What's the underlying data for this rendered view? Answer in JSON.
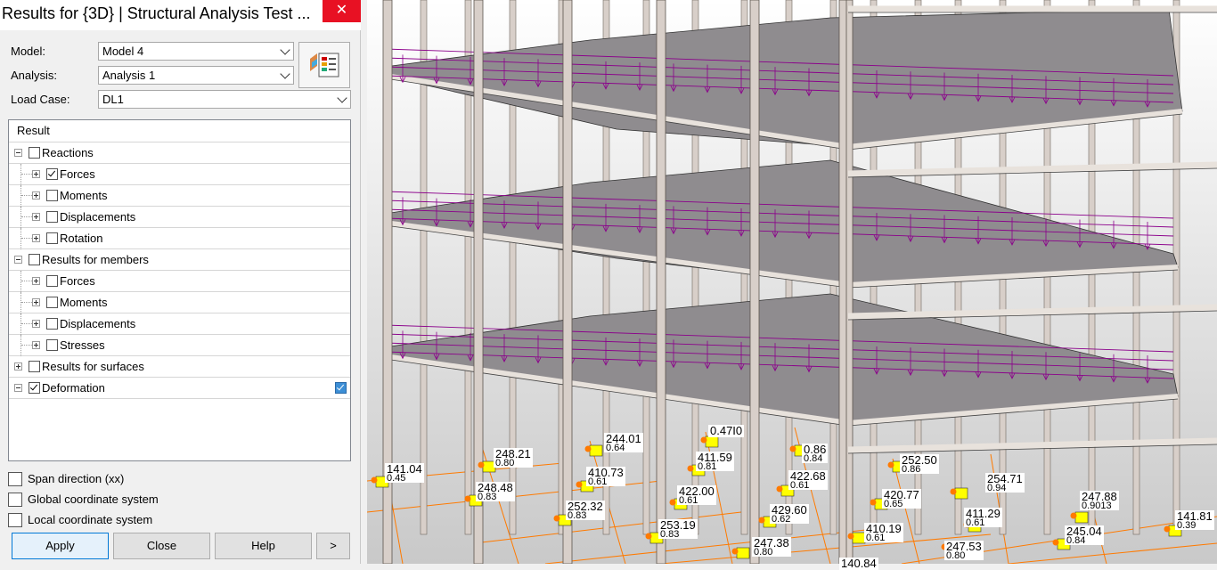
{
  "window": {
    "title": "Results for {3D} | Structural Analysis Test ...",
    "close_glyph": "✕"
  },
  "model": {
    "label": "Model:",
    "value": "Model 4"
  },
  "analysis": {
    "label": "Analysis:",
    "value": "Analysis 1"
  },
  "loadcase": {
    "label": "Load Case:",
    "value": "DL1"
  },
  "tree": {
    "header": "Result",
    "items": [
      {
        "label": "Reactions",
        "level": 0,
        "expanded": true,
        "checked": false
      },
      {
        "label": "Forces",
        "level": 1,
        "expanded": false,
        "checked": true
      },
      {
        "label": "Moments",
        "level": 1,
        "expanded": false,
        "checked": false
      },
      {
        "label": "Displacements",
        "level": 1,
        "expanded": false,
        "checked": false
      },
      {
        "label": "Rotation",
        "level": 1,
        "expanded": false,
        "checked": false
      },
      {
        "label": "Results for members",
        "level": 0,
        "expanded": true,
        "checked": false
      },
      {
        "label": "Forces",
        "level": 1,
        "expanded": false,
        "checked": false
      },
      {
        "label": "Moments",
        "level": 1,
        "expanded": false,
        "checked": false
      },
      {
        "label": "Displacements",
        "level": 1,
        "expanded": false,
        "checked": false
      },
      {
        "label": "Stresses",
        "level": 1,
        "expanded": false,
        "checked": false
      },
      {
        "label": "Results for surfaces",
        "level": 0,
        "expanded": false,
        "checked": false
      },
      {
        "label": "Deformation",
        "level": 0,
        "expanded": true,
        "checked": true
      }
    ]
  },
  "options": {
    "span": "Span direction (xx)",
    "global": "Global coordinate system",
    "local": "Local coordinate system"
  },
  "buttons": {
    "apply": "Apply",
    "close": "Close",
    "help": "Help",
    "more": ">"
  },
  "colors": {
    "load": "#8b008b",
    "slab": "#8f8c8f",
    "column": "#d8cfc9",
    "reaction": "#ff7a00",
    "support": "#ffff00"
  },
  "reactions": [
    {
      "main": "141.04",
      "sub": "0.45"
    },
    {
      "main": "248.21",
      "sub": "0.80"
    },
    {
      "main": "248.48",
      "sub": "0.83"
    },
    {
      "main": "244.01",
      "sub": "0.64"
    },
    {
      "main": "410.73",
      "sub": "0.61"
    },
    {
      "main": "252.32",
      "sub": "0.83"
    },
    {
      "main": "0.47I0",
      "sub": ""
    },
    {
      "main": "411.59",
      "sub": "0.81"
    },
    {
      "main": "422.00",
      "sub": "0.61"
    },
    {
      "main": "253.19",
      "sub": "0.83"
    },
    {
      "main": "0.86",
      "sub": "0.84"
    },
    {
      "main": "422.68",
      "sub": "0.61"
    },
    {
      "main": "429.60",
      "sub": "0.62"
    },
    {
      "main": "247.38",
      "sub": "0.80"
    },
    {
      "main": "252.50",
      "sub": "0.86"
    },
    {
      "main": "420.77",
      "sub": "0.65"
    },
    {
      "main": "410.19",
      "sub": "0.61"
    },
    {
      "main": "140.84",
      "sub": ""
    },
    {
      "main": "254.71",
      "sub": "0.94"
    },
    {
      "main": "411.29",
      "sub": "0.61"
    },
    {
      "main": "247.53",
      "sub": "0.80"
    },
    {
      "main": "247.88",
      "sub": "0.9013"
    },
    {
      "main": "245.04",
      "sub": "0.84"
    },
    {
      "main": "141.81",
      "sub": "0.39"
    }
  ]
}
